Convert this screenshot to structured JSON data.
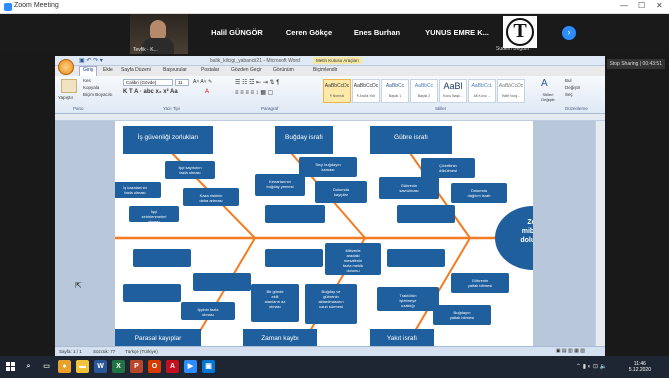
{
  "app": {
    "title": "Zoom Meeting",
    "minimize": "—",
    "maximize": "☐",
    "close": "✕"
  },
  "participants": [
    {
      "name": "Halil GÜNGÖR"
    },
    {
      "name": "Ceren Gökçe"
    },
    {
      "name": "Enes Burhan"
    },
    {
      "name": "YUNUS EMRE K..."
    },
    {
      "small": "Sudem Begüm"
    }
  ],
  "video_caption": "Tevfik - K...",
  "share_badge": "Stop Sharing | 00:43:51",
  "word": {
    "title": "balik_kilcigi_yabancii21 - Microsoft Word",
    "context_tab": "Metin Kutusu Araçları",
    "tabs": [
      "Giriş",
      "Ekle",
      "Sayfa Düzeni",
      "Başvurular",
      "Postalar",
      "Gözden Geçir",
      "Görünüm",
      "Biçimlendir"
    ],
    "font_name": "Calibri (Gövde)",
    "font_size": "11",
    "paste": "Yapıştır",
    "cut": "Kes",
    "copy": "Kopyala",
    "format_painter": "Biçim Boyacısı",
    "groups": [
      "Pano",
      "Yazı Tipi",
      "Paragraf",
      "Stiller",
      "Düzenleme"
    ],
    "styles": [
      {
        "sample": "AaBbCcDc",
        "label": "¶ Normal"
      },
      {
        "sample": "AaBbCcDc",
        "label": "¶ Aralık Yok"
      },
      {
        "sample": "AaBbCc",
        "label": "Başlık 1"
      },
      {
        "sample": "AaBbCc",
        "label": "Başlık 2"
      },
      {
        "sample": "AaBl",
        "label": "Konu Başlı..."
      },
      {
        "sample": "AaBbCcL",
        "label": "Alt Konu ..."
      },
      {
        "sample": "AaBbCcDc",
        "label": "Hafif Vurg..."
      }
    ],
    "change_styles": "Stilleri Değiştir",
    "find": "Bul",
    "replace": "Değiştir",
    "select": "Seç",
    "status_page": "Sayfa: 1 / 1",
    "status_words": "Sözcük: 77",
    "status_lang": "Türkçe (Türkiye)"
  },
  "fishbone": {
    "head": "Zor mibzer dolumu",
    "categories": [
      "İş güvenliği zorlukları",
      "Buğday israfı",
      "Gübre israfı",
      "Parasal kayıplar",
      "Zaman kaybı",
      "Yakıt israfı"
    ],
    "causes": [
      "İşçi sayısının fazla olması",
      "İş kazalarının fazla olması",
      "Kaza riskinin daha artması",
      "İşçi zehirlenmeleri olması",
      "Kenarlarının buğday yemesi",
      "Seçi buğdayın kaması",
      "Dolumda kayıplar",
      "Gübrenin savrulması",
      "Çözeltinin dökülmesi",
      "Dolumda dağılım israfı",
      "Mibzerle aradaki mesafenin fazla mekik dolumu",
      "İşçinin fazla olması",
      "Bir günde ekili alanların az olması",
      "Buğday ve gübrenin aktarılmasının uzun sürmesi",
      "Traktörün işletmeye uzaklığı",
      "Gübrenin yaltak bitmesi",
      "Buğdayın yaltak bitmesi"
    ]
  },
  "taskbar": {
    "time": "11:46",
    "date": "5.12.2020"
  }
}
